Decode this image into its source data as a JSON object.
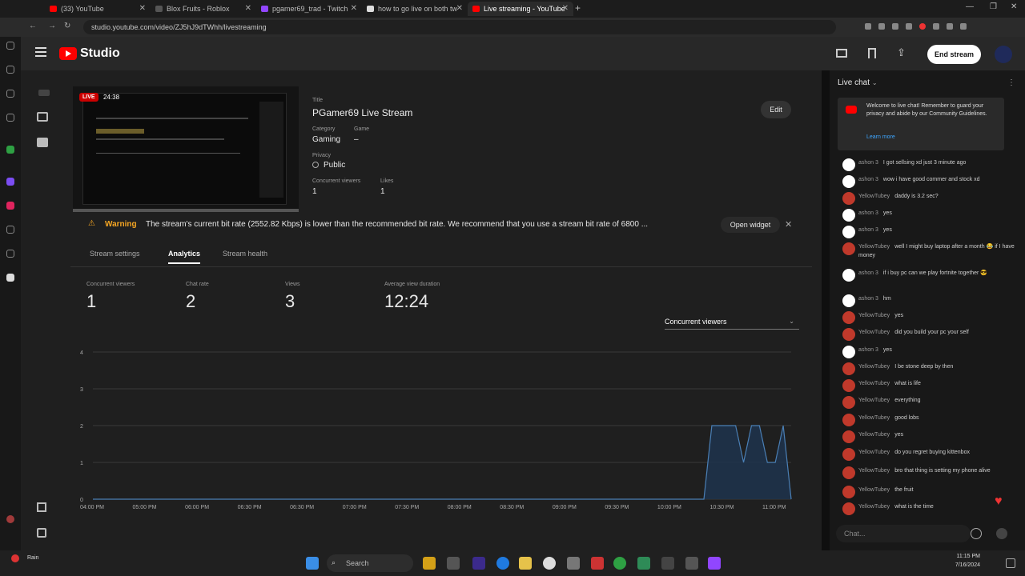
{
  "browser": {
    "tabs": [
      {
        "label": "(33) YouTube",
        "color": "#ff0000"
      },
      {
        "label": "Blox Fruits - Roblox",
        "color": "#444"
      },
      {
        "label": "pgamer69_trad - Twitch",
        "color": "#9146ff"
      },
      {
        "label": "how to go live on both tw",
        "color": "#ddd"
      },
      {
        "label": "Live streaming - YouTube",
        "color": "#ff0000"
      }
    ],
    "url": "studio.youtube.com/video/ZJ5hJ9dTWhh/livestreaming"
  },
  "header": {
    "logo_text": "Studio",
    "end_stream_label": "End stream"
  },
  "stream": {
    "live_badge": "LIVE",
    "timer": "24:38",
    "title_label": "Title",
    "title": "PGamer69 Live Stream",
    "category_label": "Category",
    "category": "Gaming",
    "game_label": "Game",
    "game": "–",
    "privacy_label": "Privacy",
    "privacy": "Public",
    "concurrent_label": "Concurrent viewers",
    "concurrent": "1",
    "likes_label": "Likes",
    "likes": "1",
    "edit_label": "Edit"
  },
  "warning": {
    "label": "Warning",
    "text": "The stream's current bit rate (2552.82 Kbps) is lower than the recommended bit rate. We recommend that you use a stream bit rate of 6800 ...",
    "open_widget": "Open widget"
  },
  "tabs": [
    "Stream settings",
    "Analytics",
    "Stream health"
  ],
  "stats": [
    {
      "label": "Concurrent viewers",
      "value": "1"
    },
    {
      "label": "Chat rate",
      "value": "2"
    },
    {
      "label": "Views",
      "value": "3"
    },
    {
      "label": "Average view duration",
      "value": "12:24"
    }
  ],
  "metric_select": "Concurrent viewers",
  "chart_data": {
    "type": "area",
    "x_ticks": [
      "04:00 PM",
      "05:00 PM",
      "06:00 PM",
      "06:30 PM",
      "06:30 PM",
      "07:00 PM",
      "07:30 PM",
      "08:00 PM",
      "08:30 PM",
      "09:00 PM",
      "09:30 PM",
      "10:00 PM",
      "10:30 PM",
      "11:00 PM"
    ],
    "y_ticks": [
      "0",
      "1",
      "2",
      "3",
      "4"
    ],
    "ylim": [
      0,
      4
    ],
    "series": [
      {
        "values": [
          0,
          0,
          0,
          0,
          0,
          0,
          0,
          0,
          0,
          0,
          0,
          0,
          0,
          0,
          0,
          0,
          0,
          0,
          0,
          0,
          0,
          0,
          0,
          0,
          0,
          0,
          0,
          0,
          0,
          0,
          0,
          0,
          0,
          0,
          0,
          0,
          0,
          0,
          0,
          0,
          0,
          0,
          0,
          0,
          0,
          0,
          0,
          0,
          0,
          0,
          0,
          0,
          0,
          0,
          0,
          0,
          0,
          0,
          0,
          0,
          0,
          0,
          0,
          0,
          0,
          0,
          0,
          0,
          0,
          0,
          0,
          0,
          0,
          0,
          0,
          0,
          0,
          0,
          2,
          2,
          2,
          2,
          1,
          2,
          2,
          1,
          1,
          2,
          0
        ]
      }
    ],
    "grid": true
  },
  "chat": {
    "title": "Live chat",
    "notice": "Welcome to live chat! Remember to guard your privacy and abide by our Community Guidelines.",
    "learn_more": "Learn more",
    "messages": [
      {
        "name": "ashon 3",
        "text": "I got sellsing xd just 3 minute ago",
        "color": "#ffffff"
      },
      {
        "name": "ashon 3",
        "text": "wow i have good commer and stock xd",
        "color": "#ffffff"
      },
      {
        "name": "YellowTubey",
        "text": "daddy is 3.2 sec?",
        "color": "#c0392b"
      },
      {
        "name": "ashon 3",
        "text": "yes",
        "color": "#ffffff"
      },
      {
        "name": "ashon 3",
        "text": "yes",
        "color": "#ffffff"
      },
      {
        "name": "YellowTubey",
        "text": "well I might buy laptop after a month 😂 if I have money",
        "color": "#c0392b"
      },
      {
        "name": "ashon 3",
        "text": "if i buy pc can we play fortnite together 😎",
        "color": "#ffffff"
      },
      {
        "name": "ashon 3",
        "text": "hm",
        "color": "#ffffff"
      },
      {
        "name": "YellowTubey",
        "text": "yes",
        "color": "#c0392b"
      },
      {
        "name": "YellowTubey",
        "text": "did you build your pc your self",
        "color": "#c0392b"
      },
      {
        "name": "ashon 3",
        "text": "yes",
        "color": "#ffffff"
      },
      {
        "name": "YellowTubey",
        "text": "I be stone deep by then",
        "color": "#c0392b"
      },
      {
        "name": "YellowTubey",
        "text": "what is life",
        "color": "#c0392b"
      },
      {
        "name": "YellowTubey",
        "text": "everything",
        "color": "#c0392b"
      },
      {
        "name": "YellowTubey",
        "text": "good lobs",
        "color": "#c0392b"
      },
      {
        "name": "YellowTubey",
        "text": "yes",
        "color": "#c0392b"
      },
      {
        "name": "YellowTubey",
        "text": "do you regret buying kittenbox",
        "color": "#c0392b"
      },
      {
        "name": "YellowTubey",
        "text": "bro that thing is setting my phone alive",
        "color": "#c0392b"
      },
      {
        "name": "YellowTubey",
        "text": "the fruit",
        "color": "#c0392b"
      },
      {
        "name": "YellowTubey",
        "text": "what is the time",
        "color": "#c0392b"
      }
    ],
    "input_placeholder": "Chat..."
  },
  "taskbar": {
    "weather": "Rain",
    "search_placeholder": "Search",
    "time": "11:15 PM",
    "date": "7/16/2024"
  },
  "colors": {
    "accent": "#3ea6ff",
    "live": "#cc0000",
    "warning": "#f5a623"
  }
}
